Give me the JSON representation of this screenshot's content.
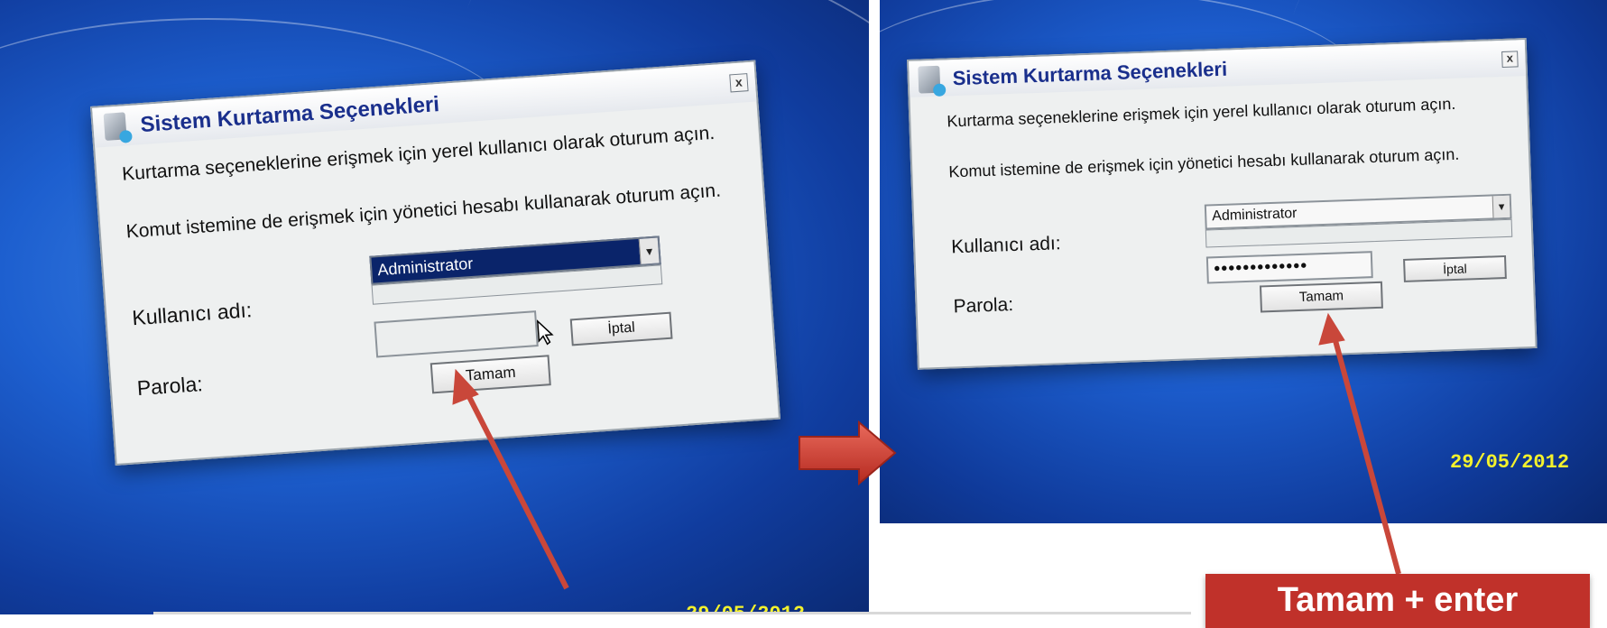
{
  "left_screenshot": {
    "dialog": {
      "title": "Sistem Kurtarma Seçenekleri",
      "close_glyph": "x",
      "instruction_1": "Kurtarma seçeneklerine erişmek için yerel kullanıcı olarak oturum açın.",
      "instruction_2": "Komut istemine de erişmek için yönetici hesabı kullanarak oturum açın.",
      "username_label": "Kullanıcı adı:",
      "username_value": "Administrator",
      "password_label": "Parola:",
      "password_value": "",
      "ok_label": "Tamam",
      "cancel_label": "İptal",
      "dropdown_glyph": "▾"
    },
    "date_stamp": "29/05/2012"
  },
  "right_screenshot": {
    "dialog": {
      "title": "Sistem Kurtarma Seçenekleri",
      "close_glyph": "x",
      "instruction_1": "Kurtarma seçeneklerine erişmek için yerel kullanıcı olarak oturum açın.",
      "instruction_2": "Komut istemine de erişmek için yönetici hesabı kullanarak oturum açın.",
      "username_label": "Kullanıcı adı:",
      "username_value": "Administrator",
      "password_label": "Parola:",
      "password_value": "•••••••••••••",
      "ok_label": "Tamam",
      "cancel_label": "İptal",
      "dropdown_glyph": "▾"
    },
    "date_stamp": "29/05/2012"
  },
  "callout": {
    "text": "Tamam + enter"
  },
  "icons": {
    "title_icon": "recovery-tool-icon",
    "transition_arrow": "right-arrow-icon"
  },
  "colors": {
    "desktop_blue": "#1d5fcf",
    "title_text": "#1a2f8c",
    "selection_blue": "#0a246a",
    "annotation_red": "#c0312a",
    "stamp_yellow": "#f4f22c"
  }
}
